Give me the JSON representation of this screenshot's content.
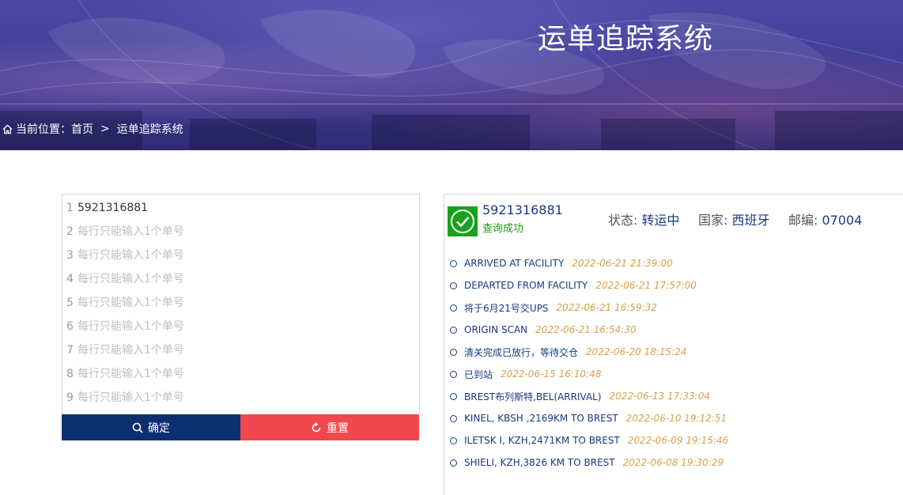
{
  "header": {
    "title": "运单追踪系统",
    "breadcrumb": {
      "label": "当前位置：",
      "home": "首页",
      "separator": ">",
      "current": "运单追踪系统"
    }
  },
  "input": {
    "lines": [
      {
        "num": "1",
        "text": "5921316881",
        "filled": true
      },
      {
        "num": "2",
        "text": "每行只能输入1个单号",
        "filled": false
      },
      {
        "num": "3",
        "text": "每行只能输入1个单号",
        "filled": false
      },
      {
        "num": "4",
        "text": "每行只能输入1个单号",
        "filled": false
      },
      {
        "num": "5",
        "text": "每行只能输入1个单号",
        "filled": false
      },
      {
        "num": "6",
        "text": "每行只能输入1个单号",
        "filled": false
      },
      {
        "num": "7",
        "text": "每行只能输入1个单号",
        "filled": false
      },
      {
        "num": "8",
        "text": "每行只能输入1个单号",
        "filled": false
      },
      {
        "num": "9",
        "text": "每行只能输入1个单号",
        "filled": false
      }
    ],
    "confirm_label": "确定",
    "reset_label": "重置"
  },
  "result": {
    "tracking_number": "5921316881",
    "query_status": "查询成功",
    "status_key": "状态:",
    "status_value": "转运中",
    "country_key": "国家:",
    "country_value": "西班牙",
    "postal_key": "邮编:",
    "postal_value": "07004",
    "events": [
      {
        "desc": "ARRIVED AT FACILITY",
        "time": "2022-06-21 21:39:00"
      },
      {
        "desc": "DEPARTED FROM FACILITY",
        "time": "2022-06-21 17:57:00"
      },
      {
        "desc": "将于6月21号交UPS",
        "time": "2022-06-21 16:59:32"
      },
      {
        "desc": "ORIGIN SCAN",
        "time": "2022-06-21 16:54:30"
      },
      {
        "desc": "清关完成已放行，等待交仓",
        "time": "2022-06-20 18:15:24"
      },
      {
        "desc": "已到站",
        "time": "2022-06-15 16:10:48"
      },
      {
        "desc": "BREST布列斯特,BEL(ARRIVAL)",
        "time": "2022-06-13 17:33:04"
      },
      {
        "desc": "KINEL, KBSH ,2169KM TO BREST",
        "time": "2022-06-10 19:12:51"
      },
      {
        "desc": "ILETSK I, KZH,2471KM TO BREST",
        "time": "2022-06-09 19:15:46"
      },
      {
        "desc": "SHIELI, KZH,3826 KM TO BREST",
        "time": "2022-06-08 19:30:29"
      }
    ]
  },
  "colors": {
    "navy": "#0c2f6f",
    "red": "#f2474e",
    "green": "#1aa01a",
    "time_orange": "#d9a046"
  }
}
